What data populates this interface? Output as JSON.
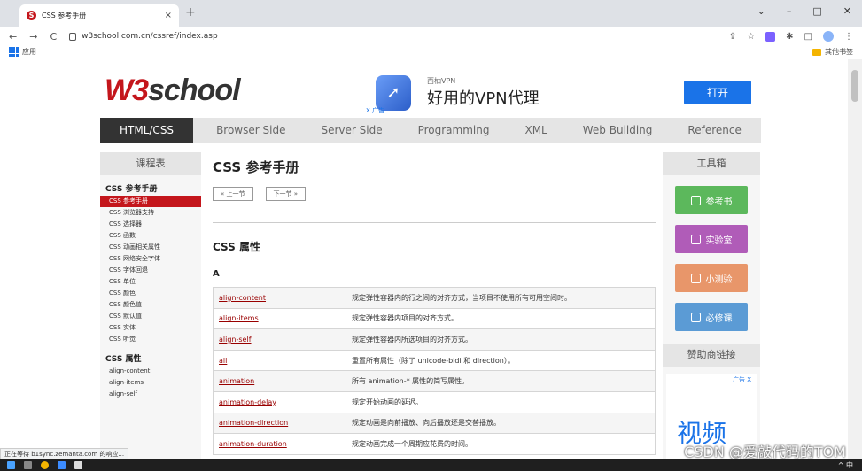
{
  "browser": {
    "tab_title": "CSS 参考手册",
    "tab_close": "×",
    "new_tab": "+",
    "url": "w3school.com.cn/cssref/index.asp",
    "apps_label": "应用",
    "bookmarks_folder": "其他书签",
    "status_text": "正在等待 b1sync.zemanta.com 的响应..."
  },
  "header": {
    "logo_w3": "W3",
    "logo_school": "school",
    "ad_small": "西柚VPN",
    "ad_big": "好用的VPN代理",
    "ad_tag": "X 广告",
    "ad_button": "打开"
  },
  "topnav": [
    "HTML/CSS",
    "Browser Side",
    "Server Side",
    "Programming",
    "XML",
    "Web Building",
    "Reference"
  ],
  "left_sidebar": {
    "heading": "课程表",
    "section1": "CSS 参考手册",
    "items1": [
      "CSS 参考手册",
      "CSS 浏览器支持",
      "CSS 选择器",
      "CSS 函数",
      "CSS 动画相关属性",
      "CSS 网络安全字体",
      "CSS 字体回退",
      "CSS 单位",
      "CSS 颜色",
      "CSS 颜色值",
      "CSS 默认值",
      "CSS 实体",
      "CSS 听觉"
    ],
    "section2": "CSS 属性",
    "items2": [
      "align-content",
      "align-items",
      "align-self"
    ]
  },
  "main": {
    "title": "CSS 参考手册",
    "prev": "« 上一节",
    "next": "下一节 »",
    "section": "CSS 属性",
    "letter": "A",
    "rows": [
      {
        "name": "align-content",
        "desc": "规定弹性容器内的行之间的对齐方式，当项目不使用所有可用空间时。"
      },
      {
        "name": "align-items",
        "desc": "规定弹性容器内项目的对齐方式。"
      },
      {
        "name": "align-self",
        "desc": "规定弹性容器内所选项目的对齐方式。"
      },
      {
        "name": "all",
        "desc": "重置所有属性（除了 unicode-bidi 和 direction）。"
      },
      {
        "name": "animation",
        "desc": "所有 animation-* 属性的简写属性。"
      },
      {
        "name": "animation-delay",
        "desc": "规定开始动画的延迟。"
      },
      {
        "name": "animation-direction",
        "desc": "规定动画是向前播放、向后播放还是交替播放。"
      },
      {
        "name": "animation-duration",
        "desc": "规定动画完成一个周期应花费的时间。"
      }
    ]
  },
  "right_sidebar": {
    "heading": "工具箱",
    "tools": [
      {
        "label": "参考书",
        "color": "#5cb85c"
      },
      {
        "label": "实验室",
        "color": "#b05cb8"
      },
      {
        "label": "小测验",
        "color": "#e8966a"
      },
      {
        "label": "必修课",
        "color": "#5b9bd5"
      }
    ],
    "sponsor_heading": "赞助商链接",
    "sponsor_tag": "广告 X",
    "sponsor_big": "视频"
  },
  "watermark": "CSDN @爱敲代码的TOM",
  "colors": {
    "brand": "#c4161c",
    "ad_button": "#1a73e8"
  }
}
